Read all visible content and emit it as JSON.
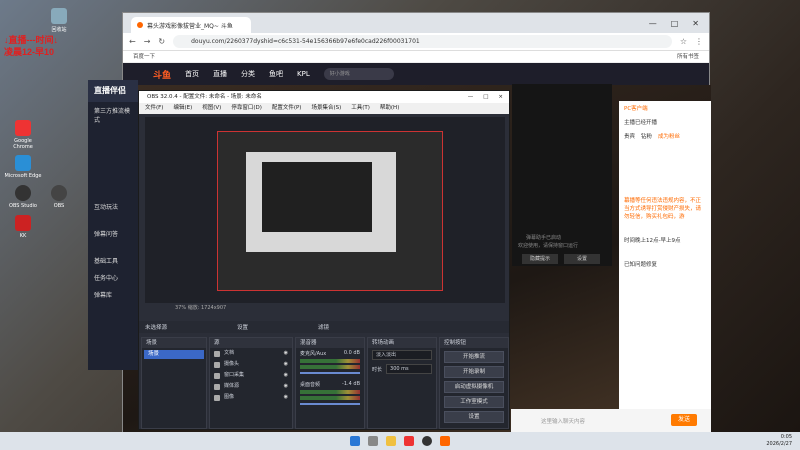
{
  "desktop": {
    "note_line1": "↓直播---时间↓",
    "note_line2": "凌晨12-早10",
    "icons": [
      "Google Chrome",
      "Microsoft Edge",
      "OBS Studio",
      "KK",
      "OBS",
      "回收站"
    ]
  },
  "browser": {
    "tab_title": "幕头游戏影像拔营业_MQ~ 斗鱼",
    "url": "douyu.com/2260377dyshid=c6c531-54e156366b97e6fe0cad226f00031701",
    "bookmark_left": "百度一下",
    "bookmark_right": "所有书签"
  },
  "douyu": {
    "logo": "斗鱼",
    "nav": [
      "首页",
      "直播",
      "分类",
      "鱼吧",
      "KPL"
    ],
    "search_placeholder": "好小游戏",
    "right_panel": {
      "pc_client": "PC客户端",
      "upload_hint": "主播已经开播",
      "tabs": [
        "贵宾",
        "钻粉",
        "成为粉丝"
      ],
      "notice": [
        "幕播等任何违法违规内容，不正当方式诱导打赏侵财产损失，请勿轻信，购买礼包码，游",
        "已知问题修复"
      ],
      "schedule": "时间晚上12点-早上9点",
      "chat_placeholder": "这里输入聊天内容",
      "send": "发送"
    },
    "count": "/120"
  },
  "zb": {
    "title": "直播伴侣",
    "items": [
      "第三方推流模式",
      "互动玩法",
      "弹幕问答",
      "基础工具",
      "任务中心",
      "弹幕库"
    ]
  },
  "obs": {
    "title": "OBS 32.0.4 - 配置文件: 未命名 - 场景: 未命名",
    "window_controls": [
      "—",
      "□",
      "×"
    ],
    "menu": [
      "文件(F)",
      "编辑(E)",
      "视图(V)",
      "停靠窗口(D)",
      "配置文件(P)",
      "场景集合(S)",
      "工具(T)",
      "帮助(H)"
    ],
    "status": "37% 缩放: 1724x907",
    "toolbar": [
      "未选择源",
      "设置",
      "滤镜"
    ],
    "docks": {
      "scenes": "场景",
      "sources": "源",
      "mixer": "混音器",
      "transitions": "转场动画",
      "controls": "控制按钮"
    },
    "scene_item": "场景",
    "sources": [
      "文档",
      "摄像头",
      "窗口采集",
      "媒体源",
      "图像"
    ],
    "mixer_channels": [
      {
        "name": "麦克风/Aux",
        "level": "0.0 dB"
      },
      {
        "name": "桌面音频",
        "level": "-1.4 dB"
      }
    ],
    "transition_type": "淡入淡出",
    "duration_label": "时长",
    "duration_value": "300 ms",
    "controls_buttons": [
      "开始推流",
      "开始录制",
      "启动虚拟摄像机",
      "工作室模式",
      "设置"
    ]
  },
  "popup": {
    "text": "弹幕助手已启动",
    "sub": "欢迎使用，请保持窗口运行",
    "buttons": [
      "隐藏提示",
      "设置"
    ]
  },
  "taskbar": {
    "time": "0:05",
    "date": "2026/2/27"
  }
}
